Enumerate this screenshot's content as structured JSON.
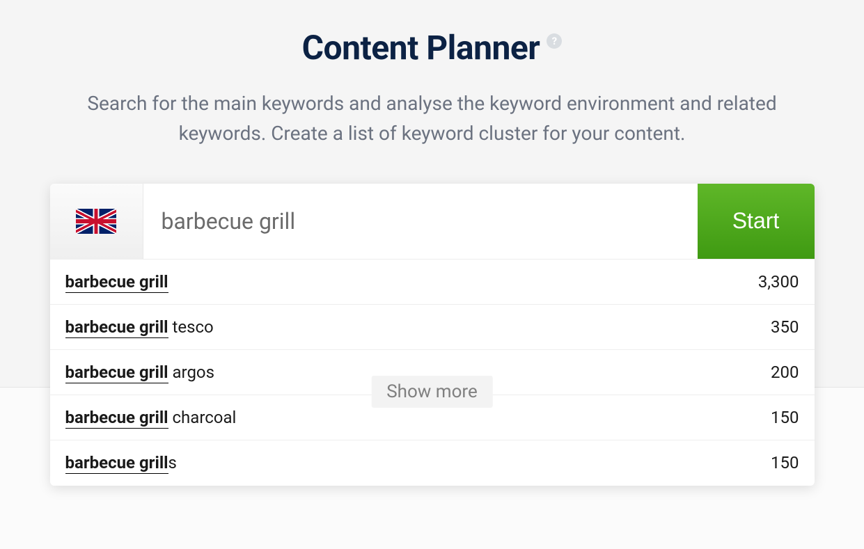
{
  "header": {
    "title": "Content Planner",
    "help_glyph": "?",
    "subtitle": "Search for the main keywords and analyse the keyword environment and related keywords. Create a list of keyword cluster for your content."
  },
  "search": {
    "country_code": "uk",
    "input_value": "barbecue grill",
    "start_label": "Start"
  },
  "suggestions": [
    {
      "match": "barbecue grill",
      "suffix": "",
      "count": "3,300"
    },
    {
      "match": "barbecue grill",
      "suffix": " tesco",
      "count": "350"
    },
    {
      "match": "barbecue grill",
      "suffix": " argos",
      "count": "200"
    },
    {
      "match": "barbecue grill",
      "suffix": " charcoal",
      "count": "150"
    },
    {
      "match": "barbecue grill",
      "suffix": "s",
      "count": "150"
    }
  ],
  "show_more_label": "Show more"
}
